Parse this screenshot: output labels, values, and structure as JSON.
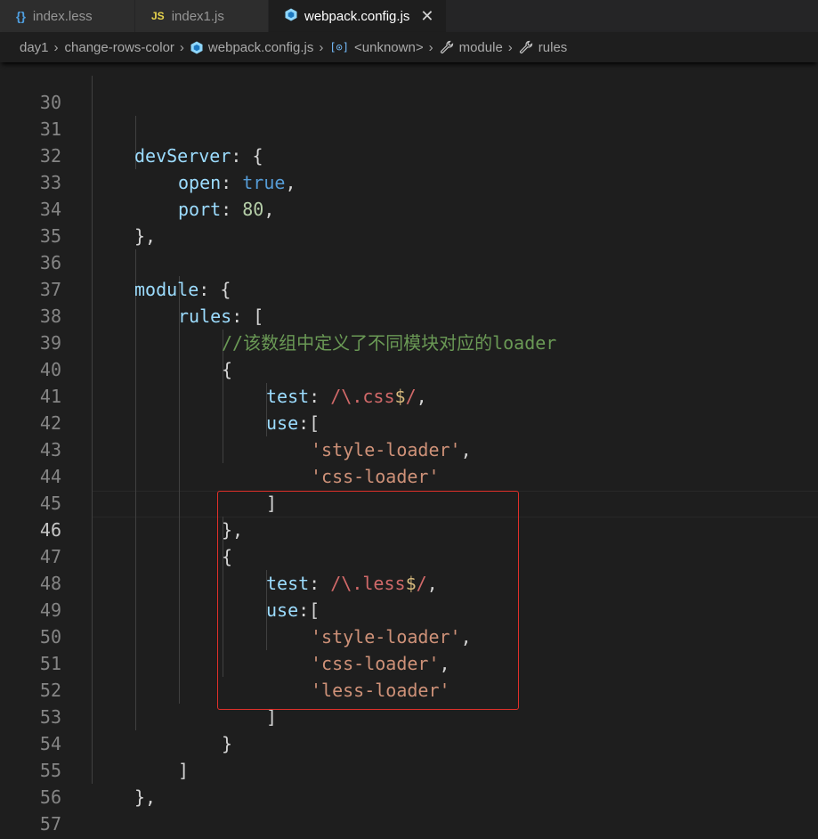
{
  "tabs": [
    {
      "label": "index.less",
      "icon": "braces-icon",
      "icon_text": "{}",
      "active": false
    },
    {
      "label": "index1.js",
      "icon": "js-file-icon",
      "icon_text": "JS",
      "active": false
    },
    {
      "label": "webpack.config.js",
      "icon": "webpack-cube-icon",
      "active": true
    }
  ],
  "breadcrumb": {
    "items": [
      "day1",
      "change-rows-color",
      "webpack.config.js",
      "<unknown>",
      "module",
      "rules"
    ]
  },
  "editor": {
    "current_line": 46,
    "line_numbers": [
      "30",
      "31",
      "32",
      "33",
      "34",
      "35",
      "36",
      "37",
      "38",
      "39",
      "40",
      "41",
      "42",
      "43",
      "44",
      "45",
      "46",
      "47",
      "48",
      "49",
      "50",
      "51",
      "52",
      "53",
      "54",
      "55",
      "56",
      "57"
    ]
  },
  "code": {
    "l31_prop": "devServer",
    "l31_rest": ": {",
    "l32_prop": "open",
    "l32_sep": ": ",
    "l32_val": "true",
    "l32_end": ",",
    "l33_prop": "port",
    "l33_sep": ": ",
    "l33_val": "80",
    "l33_end": ",",
    "l34": "},",
    "l36_prop": "module",
    "l36_rest": ": {",
    "l37_prop": "rules",
    "l37_rest": ": [",
    "l38_comment_a": "//",
    "l38_comment_cjk": "该数组中定义了不同模块对应的",
    "l38_comment_b": "loader",
    "l39": "{",
    "l40_prop": "test",
    "l40_sep": ": ",
    "l40_re_open": "/\\.",
    "l40_re_body": "css",
    "l40_re_anchor": "$",
    "l40_re_close": "/",
    "l40_end": ",",
    "l41_prop": "use",
    "l41_rest": ":[",
    "l42_str": "'style-loader'",
    "l42_end": ",",
    "l43_str": "'css-loader'",
    "l44": "]",
    "l45": "},",
    "l46": "{",
    "l47_prop": "test",
    "l47_sep": ": ",
    "l47_re_open": "/\\.",
    "l47_re_body": "less",
    "l47_re_anchor": "$",
    "l47_re_close": "/",
    "l47_end": ",",
    "l48_prop": "use",
    "l48_rest": ":[",
    "l49_str": "'style-loader'",
    "l49_end": ",",
    "l50_str": "'css-loader'",
    "l50_end": ",",
    "l51_str": "'less-loader'",
    "l52": "]",
    "l53": "}",
    "l54": "]",
    "l55": "},",
    "l57": "};"
  },
  "colors": {
    "editor_bg": "#1e1e1e",
    "highlight_box": "#e0302a",
    "property": "#9cdcfe",
    "string": "#ce9178",
    "comment": "#6a9955"
  }
}
